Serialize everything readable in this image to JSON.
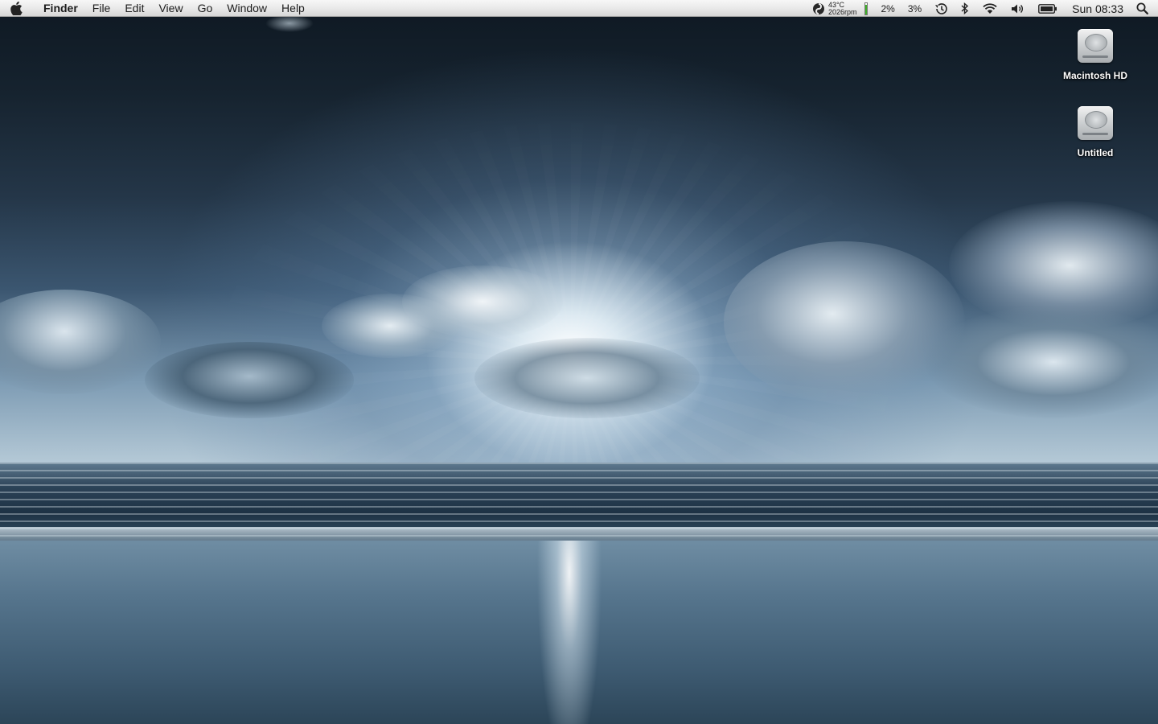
{
  "menubar": {
    "apple_icon": "apple-logo-icon",
    "app_name": "Finder",
    "menus": [
      "File",
      "Edit",
      "View",
      "Go",
      "Window",
      "Help"
    ],
    "status": {
      "temperature": "43°C",
      "fan_speed": "2026rpm",
      "level_fraction": 0.85,
      "level_color": "#3fae2a",
      "cpu1": "2%",
      "cpu2": "3%",
      "clock": "Sun 08:33"
    }
  },
  "desktop": {
    "icons": [
      {
        "label": "Macintosh HD",
        "icon": "hard-drive-icon"
      },
      {
        "label": "Untitled",
        "icon": "hard-drive-icon"
      }
    ]
  },
  "wallpaper": {
    "description": "ocean-sunburst"
  }
}
